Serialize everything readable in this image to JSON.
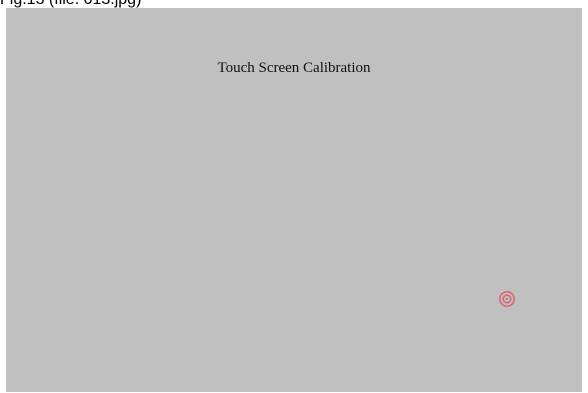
{
  "caption": "Fig.13  (file: 013.jpg)",
  "screen": {
    "title": "Touch Screen Calibration",
    "background_color": "#c0c0c0",
    "target": {
      "icon": "calibration-target-icon",
      "color": "#e05a6a"
    }
  }
}
